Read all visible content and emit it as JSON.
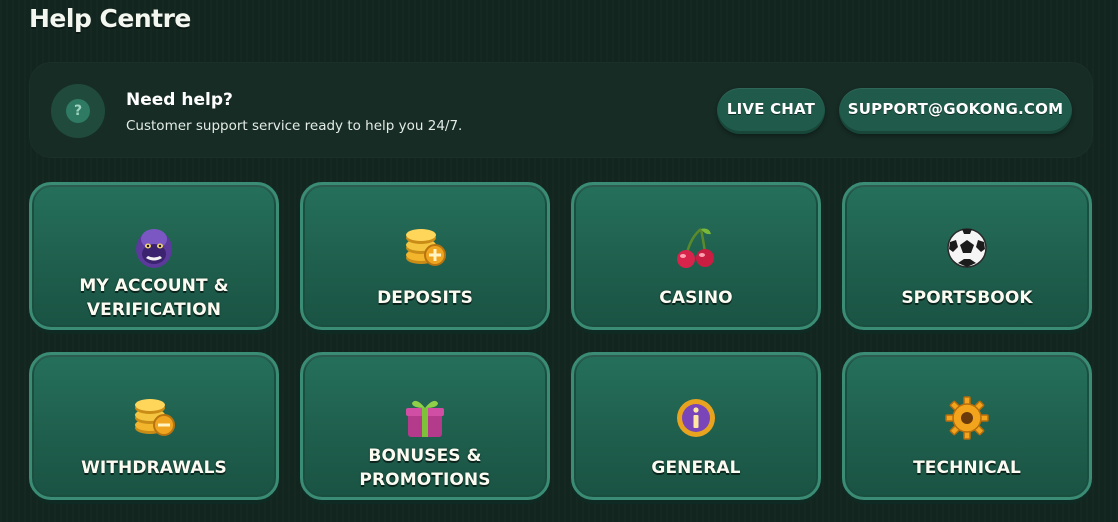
{
  "page": {
    "title": "Help Centre"
  },
  "help_banner": {
    "title": "Need help?",
    "subtitle": "Customer support service ready to help you 24/7.",
    "icon": "question-icon",
    "live_chat_label": "LIVE CHAT",
    "email_label": "SUPPORT@GOKONG.COM"
  },
  "categories": [
    {
      "label_line1": "MY ACCOUNT &",
      "label_line2": "VERIFICATION",
      "icon": "gorilla-icon"
    },
    {
      "label_line1": "DEPOSITS",
      "icon": "coins-plus-icon"
    },
    {
      "label_line1": "CASINO",
      "icon": "cherries-icon"
    },
    {
      "label_line1": "SPORTSBOOK",
      "icon": "soccer-ball-icon"
    },
    {
      "label_line1": "WITHDRAWALS",
      "icon": "coins-minus-icon"
    },
    {
      "label_line1": "BONUSES &",
      "label_line2": "PROMOTIONS",
      "icon": "gift-icon"
    },
    {
      "label_line1": "GENERAL",
      "icon": "info-icon"
    },
    {
      "label_line1": "TECHNICAL",
      "icon": "gear-icon"
    }
  ],
  "colors": {
    "background": "#13251f",
    "card": "#216452",
    "card_border": "#3a8c74",
    "pill": "#1f5a4a"
  }
}
